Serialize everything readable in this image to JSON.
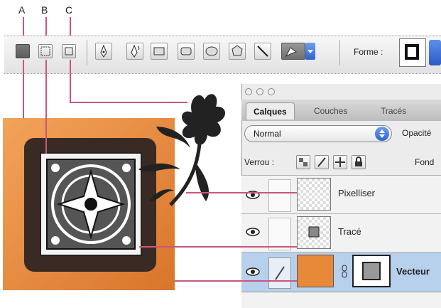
{
  "callouts": {
    "a": "A",
    "b": "B",
    "c": "C"
  },
  "toolbar": {
    "mode_buttons": [
      {
        "name": "shape-layers-mode",
        "active": true
      },
      {
        "name": "paths-mode",
        "active": false
      },
      {
        "name": "fill-pixels-mode",
        "active": false
      }
    ],
    "tools": [
      "pen-tool",
      "freeform-pen-tool",
      "rectangle-tool",
      "rounded-rectangle-tool",
      "ellipse-tool",
      "polygon-tool",
      "line-tool",
      "custom-shape-tool"
    ],
    "shape_label": "Forme :"
  },
  "panel": {
    "tabs": [
      {
        "label": "Calques",
        "active": true
      },
      {
        "label": "Couches",
        "active": false
      },
      {
        "label": "Tracés",
        "active": false
      }
    ],
    "blend_mode": "Normal",
    "opacity_label": "Opacité",
    "lock_label": "Verrou :",
    "fill_label": "Fond",
    "layers": [
      {
        "name": "Pixelliser",
        "selected": false
      },
      {
        "name": "Tracé",
        "selected": false
      },
      {
        "name": "Vecteur",
        "selected": true,
        "color": "#e8893a"
      }
    ]
  },
  "colors": {
    "accent": "#e8893a",
    "selection": "#b7d0ec",
    "callout_line": "#c8577b"
  }
}
